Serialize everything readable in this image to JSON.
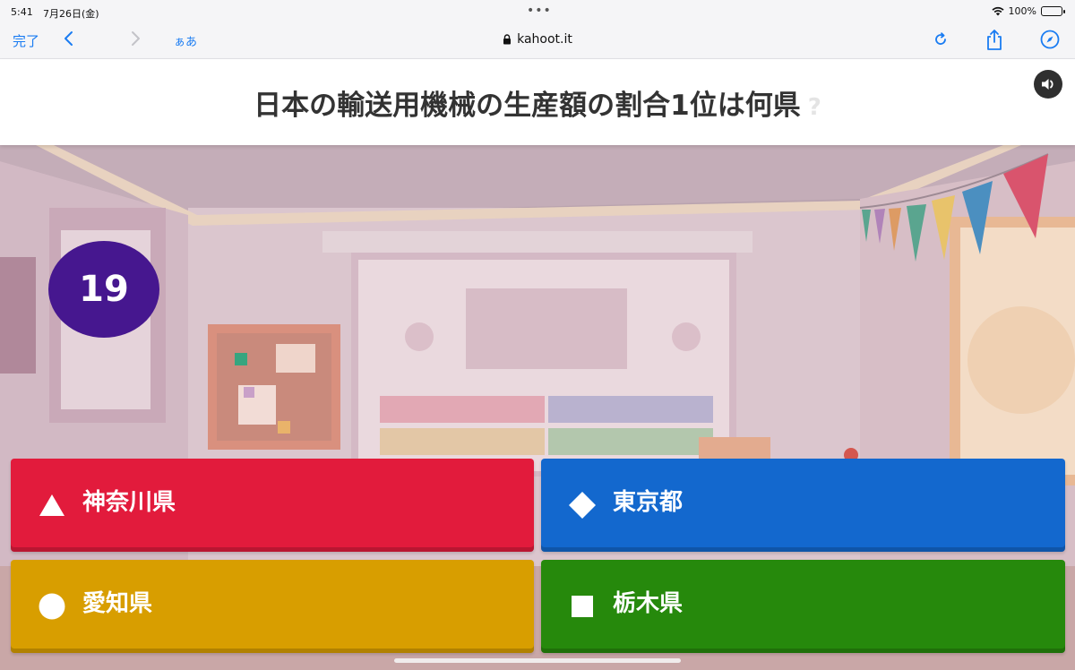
{
  "status_bar": {
    "time": "5:41",
    "date": "7月26日(金)",
    "multitask_dots": "•••",
    "battery": "100%"
  },
  "browser": {
    "done_label": "完了",
    "text_size_label": "ぁあ",
    "url": "kahoot.it",
    "accent_color": "#1a7cf2"
  },
  "question": {
    "text": "日本の輸送用機械の生産額の割合1位は何県",
    "mark": "?"
  },
  "timer": {
    "seconds": "19",
    "color": "#46178f"
  },
  "answers": [
    {
      "shape": "triangle-icon",
      "label": "神奈川県",
      "color": "#e21b3c"
    },
    {
      "shape": "diamond-icon",
      "label": "東京都",
      "color": "#1368ce"
    },
    {
      "shape": "circle-icon",
      "label": "愛知県",
      "color": "#d89e00"
    },
    {
      "shape": "square-icon",
      "label": "栃木県",
      "color": "#26890c"
    }
  ]
}
